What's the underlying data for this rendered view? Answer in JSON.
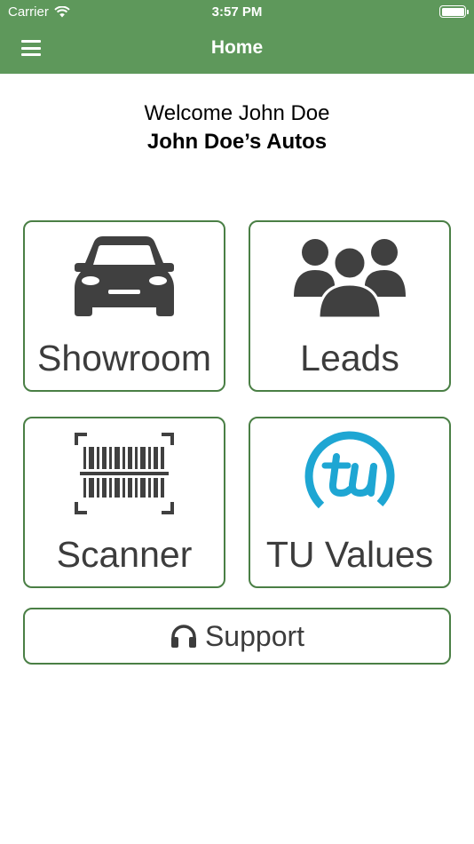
{
  "status_bar": {
    "carrier": "Carrier",
    "time": "3:57 PM"
  },
  "nav": {
    "title": "Home",
    "menu_icon": "hamburger-menu-icon"
  },
  "welcome": {
    "greeting": "Welcome John Doe",
    "dealer_name": "John Doe’s Autos"
  },
  "tiles": [
    {
      "label": "Showroom",
      "icon": "car-icon"
    },
    {
      "label": "Leads",
      "icon": "people-group-icon"
    },
    {
      "label": "Scanner",
      "icon": "barcode-scanner-icon"
    },
    {
      "label": "TU Values",
      "icon": "tu-logo"
    }
  ],
  "support": {
    "label": "Support",
    "icon": "headset-icon"
  },
  "colors": {
    "header": "#5e985b",
    "tile_border": "#4a7f45",
    "icon": "#404040",
    "tu_blue": "#1ea6d3"
  }
}
